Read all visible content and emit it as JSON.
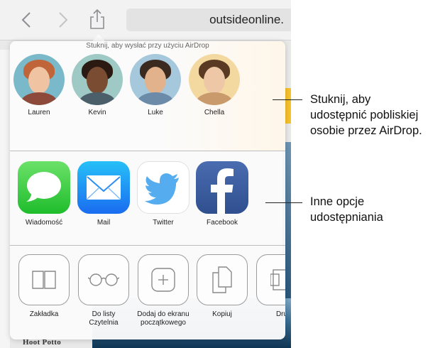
{
  "browser": {
    "url_text": "outsideonline.",
    "headline_fragment": "Hoot Potto"
  },
  "share_sheet": {
    "airdrop_hint": "Stuknij, aby wysłać przy użyciu AirDrop",
    "people": [
      {
        "name": "Lauren"
      },
      {
        "name": "Kevin"
      },
      {
        "name": "Luke"
      },
      {
        "name": "Chella"
      }
    ],
    "apps": [
      {
        "label": "Wiadomość",
        "icon": "messages-icon",
        "color": "#4cd964"
      },
      {
        "label": "Mail",
        "icon": "mail-icon",
        "color": "#1e7cf2"
      },
      {
        "label": "Twitter",
        "icon": "twitter-icon",
        "color": "#55acee"
      },
      {
        "label": "Facebook",
        "icon": "facebook-icon",
        "color": "#3b5998"
      }
    ],
    "actions": [
      {
        "label": "Zakładka",
        "icon": "book-icon"
      },
      {
        "label": "Do listy\nCzytelnia",
        "icon": "glasses-icon"
      },
      {
        "label": "Dodaj do ekranu\npoczątkowego",
        "icon": "add-icon"
      },
      {
        "label": "Kopiuj",
        "icon": "copy-icon"
      },
      {
        "label": "Dru",
        "icon": "print-icon"
      }
    ]
  },
  "callouts": {
    "airdrop": "Stuknij, aby\nudostępnić pobliskiej\nosobie przez AirDrop.",
    "other": "Inne opcje\nudostępniania"
  }
}
